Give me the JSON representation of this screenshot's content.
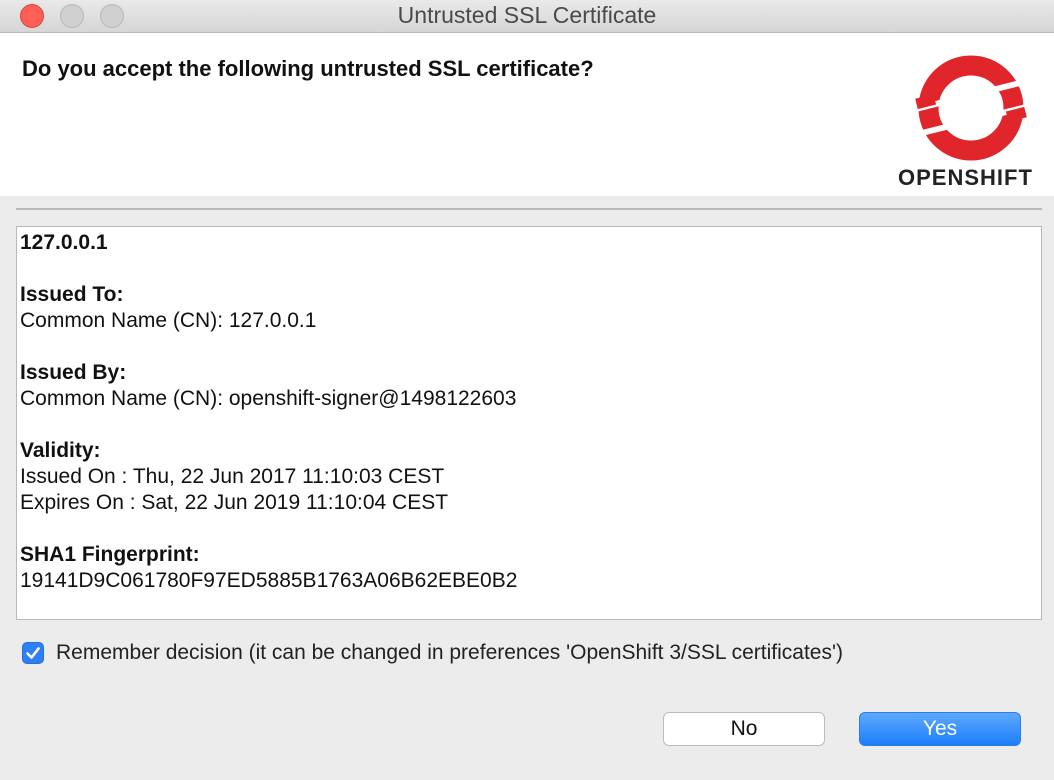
{
  "window": {
    "title": "Untrusted SSL Certificate"
  },
  "header": {
    "question": "Do you accept the following untrusted SSL certificate?",
    "logo_text": "OPENSHIFT",
    "logo_icon": "openshift-logo-icon",
    "logo_color": "#e0262b"
  },
  "certificate": {
    "host": "127.0.0.1",
    "issued_to_heading": "Issued To:",
    "issued_to_cn": "Common Name (CN): 127.0.0.1",
    "issued_by_heading": "Issued By:",
    "issued_by_cn": "Common Name (CN): openshift-signer@1498122603",
    "validity_heading": "Validity:",
    "issued_on": "Issued On : Thu, 22 Jun 2017 11:10:03 CEST",
    "expires_on": "Expires On : Sat, 22 Jun 2019 11:10:04 CEST",
    "fingerprint_heading": "SHA1 Fingerprint:",
    "fingerprint": "19141D9C061780F97ED5885B1763A06B62EBE0B2"
  },
  "remember": {
    "checked": true,
    "label": "Remember decision (it can be changed in preferences 'OpenShift 3/SSL certificates')"
  },
  "buttons": {
    "no_label": "No",
    "yes_label": "Yes"
  },
  "colors": {
    "accent": "#2f7ff7",
    "close_light": "#fc5f57"
  }
}
